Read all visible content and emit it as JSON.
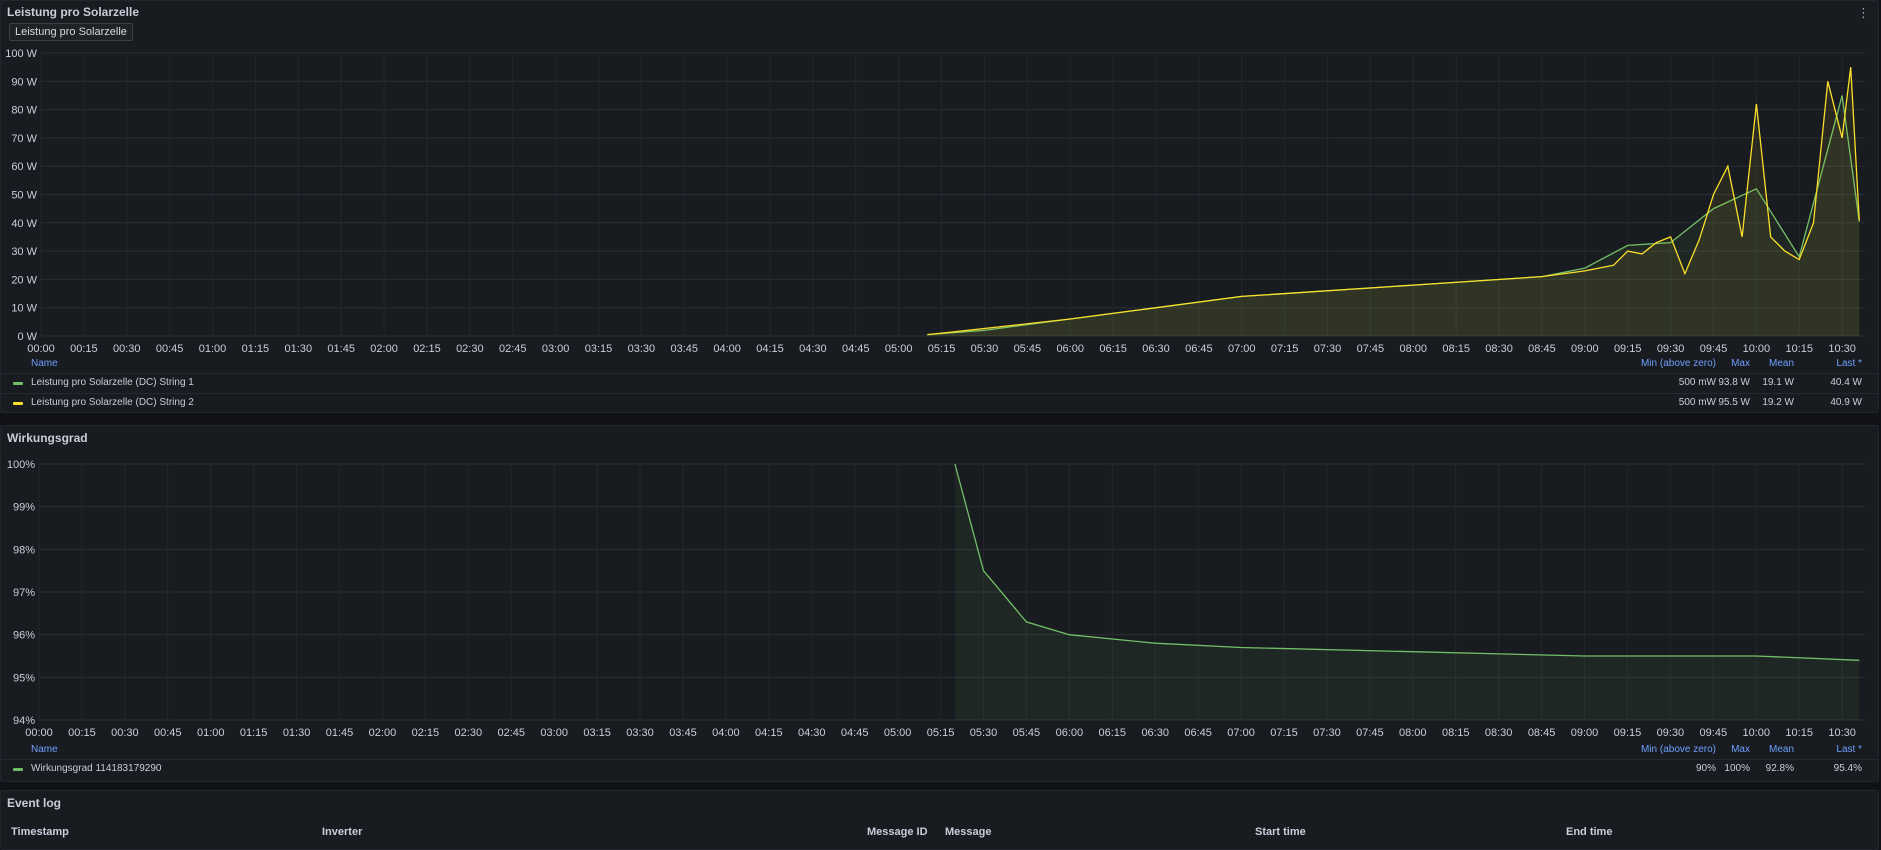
{
  "time_labels": [
    "00:00",
    "00:15",
    "00:30",
    "00:45",
    "01:00",
    "01:15",
    "01:30",
    "01:45",
    "02:00",
    "02:15",
    "02:30",
    "02:45",
    "03:00",
    "03:15",
    "03:30",
    "03:45",
    "04:00",
    "04:15",
    "04:30",
    "04:45",
    "05:00",
    "05:15",
    "05:30",
    "05:45",
    "06:00",
    "06:15",
    "06:30",
    "06:45",
    "07:00",
    "07:15",
    "07:30",
    "07:45",
    "08:00",
    "08:15",
    "08:30",
    "08:45",
    "09:00",
    "09:15",
    "09:30",
    "09:45",
    "10:00",
    "10:15",
    "10:30"
  ],
  "colors": {
    "green": "#73bf69",
    "yellow": "#fade2a",
    "link_blue": "#6e9fff"
  },
  "panel_power": {
    "title": "Leistung pro Solarzelle",
    "chip_label": "Leistung pro Solarzelle",
    "menu_glyph": "⋮",
    "chart_data": {
      "type": "line",
      "ylim": [
        0,
        100
      ],
      "yticks": [
        "0 W",
        "10 W",
        "20 W",
        "30 W",
        "40 W",
        "50 W",
        "60 W",
        "70 W",
        "80 W",
        "90 W",
        "100 W"
      ],
      "series": [
        {
          "name": "Leistung pro Solarzelle (DC) String 1",
          "color": "#73bf69",
          "t": [
            "05:10",
            "05:30",
            "06:00",
            "07:00",
            "08:00",
            "08:45",
            "09:00",
            "09:15",
            "09:30",
            "09:45",
            "10:00",
            "10:15",
            "10:30",
            "10:36"
          ],
          "values": [
            0.5,
            2,
            6,
            14,
            18,
            21,
            24,
            32,
            33,
            45,
            52,
            28,
            85,
            40.4
          ]
        },
        {
          "name": "Leistung pro Solarzelle (DC) String 2",
          "color": "#fade2a",
          "t": [
            "05:10",
            "05:15",
            "06:00",
            "07:00",
            "08:00",
            "08:45",
            "09:00",
            "09:10",
            "09:15",
            "09:20",
            "09:25",
            "09:30",
            "09:35",
            "09:40",
            "09:45",
            "09:50",
            "09:55",
            "10:00",
            "10:05",
            "10:10",
            "10:15",
            "10:20",
            "10:25",
            "10:30",
            "10:33",
            "10:36"
          ],
          "values": [
            0.5,
            1,
            6,
            14,
            18,
            21,
            23,
            25,
            30,
            29,
            33,
            35,
            22,
            34,
            50,
            60,
            35,
            82,
            35,
            30,
            27,
            40,
            90,
            70,
            95,
            40.9
          ]
        }
      ]
    },
    "legend": {
      "header": {
        "name": "Name",
        "min": "Min (above zero)",
        "max": "Max",
        "mean": "Mean",
        "last": "Last *"
      },
      "rows": [
        {
          "name": "Leistung pro Solarzelle (DC) String 1",
          "min": "500 mW",
          "max": "93.8 W",
          "mean": "19.1 W",
          "last": "40.4 W",
          "color": "#73bf69"
        },
        {
          "name": "Leistung pro Solarzelle (DC) String 2",
          "min": "500 mW",
          "max": "95.5 W",
          "mean": "19.2 W",
          "last": "40.9 W",
          "color": "#fade2a"
        }
      ]
    }
  },
  "panel_efficiency": {
    "title": "Wirkungsgrad",
    "chart_data": {
      "type": "line",
      "ylim": [
        94,
        100
      ],
      "yticks": [
        "94%",
        "95%",
        "96%",
        "97%",
        "98%",
        "99%",
        "100%"
      ],
      "series": [
        {
          "name": "Wirkungsgrad 114183179290",
          "color": "#73bf69",
          "t": [
            "05:20",
            "05:30",
            "05:45",
            "06:00",
            "06:30",
            "07:00",
            "08:00",
            "09:00",
            "10:00",
            "10:36"
          ],
          "values": [
            100,
            97.5,
            96.3,
            96.0,
            95.8,
            95.7,
            95.6,
            95.5,
            95.5,
            95.4
          ]
        }
      ]
    },
    "legend": {
      "header": {
        "name": "Name",
        "min": "Min (above zero)",
        "max": "Max",
        "mean": "Mean",
        "last": "Last *"
      },
      "rows": [
        {
          "name": "Wirkungsgrad 114183179290",
          "min": "90%",
          "max": "100%",
          "mean": "92.8%",
          "last": "95.4%",
          "color": "#73bf69"
        }
      ]
    }
  },
  "panel_events": {
    "title": "Event log",
    "columns": [
      "Timestamp",
      "Inverter",
      "Message ID",
      "Message",
      "Start time",
      "End time"
    ]
  }
}
